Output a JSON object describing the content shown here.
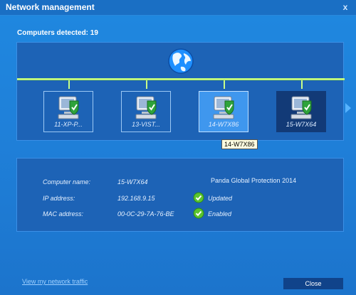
{
  "window": {
    "title": "Network management",
    "close_glyph": "x"
  },
  "summary": {
    "detected_text": "Computers detected: 19"
  },
  "network": {
    "computers": [
      {
        "label": "11-XP-P...",
        "state": "normal"
      },
      {
        "label": "13-VIST...",
        "state": "normal"
      },
      {
        "label": "14-W7X86",
        "state": "hover"
      },
      {
        "label": "15-W7X64",
        "state": "selected"
      }
    ],
    "tooltip": "14-W7X86",
    "icons": {
      "globe": "globe-icon",
      "computer": "computer-shield-icon",
      "next": "arrow-right-icon"
    }
  },
  "details": {
    "computer_name_label": "Computer name:",
    "computer_name_value": "15-W7X64",
    "ip_label": "IP address:",
    "ip_value": "192.168.9.15",
    "mac_label": "MAC address:",
    "mac_value": "00-0C-29-7A-76-BE",
    "product": "Panda Global Protection 2014",
    "status_1": "Updated",
    "status_2": "Enabled"
  },
  "footer": {
    "link": "View my network traffic",
    "close_label": "Close"
  },
  "colors": {
    "accent": "#1f7fd8",
    "panel": "#1d63b6",
    "selected": "#123a77",
    "check": "#5bc52f"
  }
}
